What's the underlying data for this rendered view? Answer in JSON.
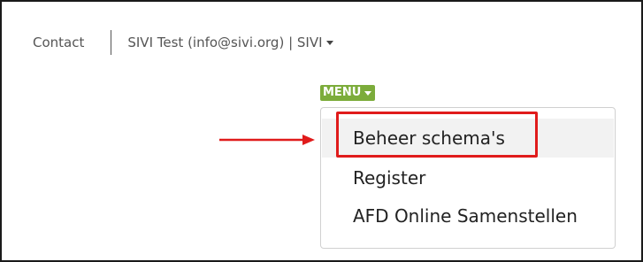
{
  "topbar": {
    "contact_label": "Contact",
    "account_label": "SIVI Test (info@sivi.org) | SIVI"
  },
  "menu": {
    "button_label": "MENU",
    "items": [
      {
        "label": "Beheer schema's"
      },
      {
        "label": "Register"
      },
      {
        "label": "AFD Online Samenstellen"
      }
    ]
  },
  "colors": {
    "menu_accent": "#7cac3b",
    "annotation": "#e01b1b"
  }
}
